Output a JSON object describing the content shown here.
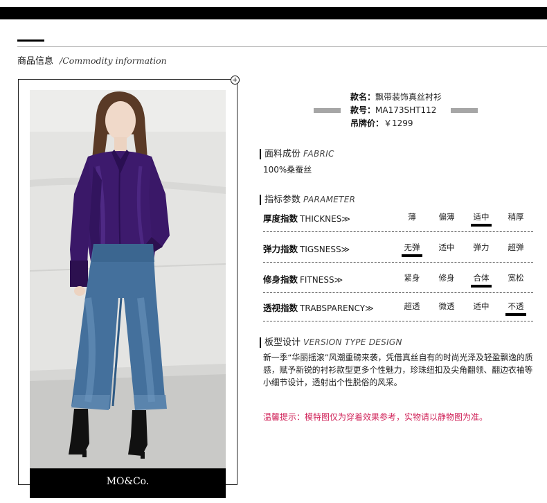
{
  "header": {
    "title_cn": "商品信息",
    "title_en": "/Commodity information"
  },
  "photo": {
    "brand": "MO&Co.",
    "colors": {
      "blouse": "#3b1a6b",
      "denim": "#3f6f9e",
      "wall": "#e6e6e4"
    }
  },
  "product": {
    "name_label": "款名：",
    "name_value": "飘带装饰真丝衬衫",
    "code_label": "款号：",
    "code_value": "MA173SHT112",
    "price_label": "吊牌价：",
    "price_value": "￥1299"
  },
  "fabric": {
    "title_cn": "面料成份",
    "title_en": "FABRIC",
    "value": "100%桑蚕丝"
  },
  "parameter": {
    "title_cn": "指标参数",
    "title_en": "PARAMETER",
    "rows": [
      {
        "label_cn": "厚度指数",
        "label_en": "THICKNES≫",
        "options": [
          "薄",
          "偏薄",
          "适中",
          "稍厚"
        ],
        "selected": "适中"
      },
      {
        "label_cn": "弹力指数",
        "label_en": "TIGSNESS≫",
        "options": [
          "无弹",
          "适中",
          "弹力",
          "超弹"
        ],
        "selected": "无弹"
      },
      {
        "label_cn": "修身指数",
        "label_en": "FITNESS≫",
        "options": [
          "紧身",
          "修身",
          "合体",
          "宽松"
        ],
        "selected": "合体"
      },
      {
        "label_cn": "透视指数",
        "label_en": "TRABSPARENCY≫",
        "options": [
          "超透",
          "微透",
          "适中",
          "不透"
        ],
        "selected": "不透"
      }
    ]
  },
  "design": {
    "title_cn": "板型设计",
    "title_en": "VERSION TYPE DESIGN",
    "text": "新一季“华丽摇滚”风潮重磅来袭，凭借真丝自有的时尚光泽及轻盈飘逸的质感，赋予新锐的衬衫款型更多个性魅力，珍珠纽扣及尖角翻领、翻边衣袖等小细节设计，透射出个性脱俗的风采。"
  },
  "notice": {
    "text": "温馨提示：模特图仅为穿着效果参考，实物请以静物图为准。",
    "color": "#d0245a"
  }
}
